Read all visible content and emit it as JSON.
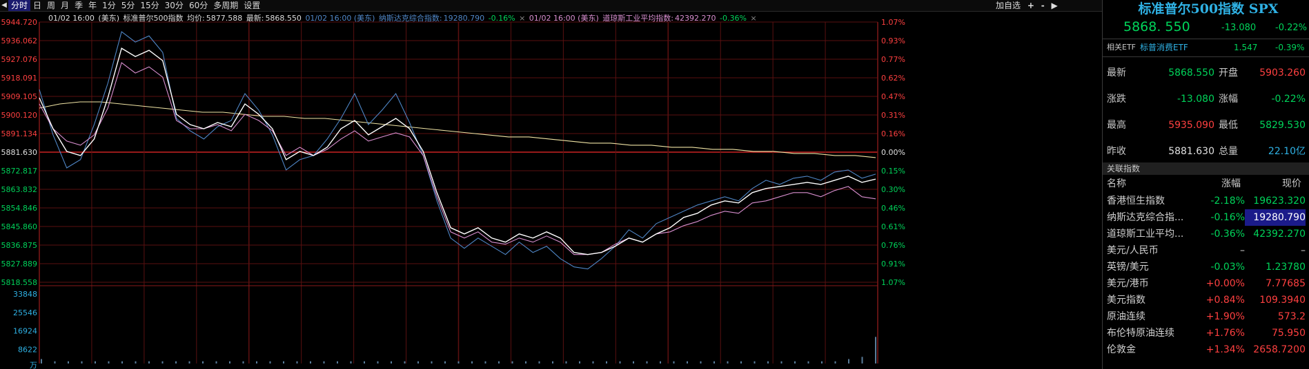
{
  "toolbar": {
    "periods": [
      "分时",
      "日",
      "周",
      "月",
      "季",
      "年",
      "1分",
      "5分",
      "15分",
      "30分",
      "60分",
      "多周期",
      "设置"
    ],
    "active_period": "分时",
    "add_watch_label": "加自选",
    "plus_label": "+",
    "minus_label": "-"
  },
  "info": {
    "time": "01/02 16:00",
    "tz": "(美东)",
    "name": "标准普尔500指数",
    "avg_label": "均价:",
    "avg": "5877.588",
    "latest_label": "最新:",
    "latest": "5868.550",
    "overlay1_label": "01/02 16:00 (美东)",
    "overlay1_name": "纳斯达克综合指数:",
    "overlay1_value": "19280.790",
    "overlay1_pct": "-0.16%",
    "overlay2_label": "01/02 16:00 (美东)",
    "overlay2_name": "道琼斯工业平均指数:",
    "overlay2_value": "42392.270",
    "overlay2_pct": "-0.36%",
    "close_symbol": "×"
  },
  "chart_data": {
    "type": "line",
    "price_axis_labels": [
      "5944.720",
      "5936.062",
      "5927.076",
      "5918.091",
      "5909.105",
      "5900.120",
      "5891.134",
      "5881.630",
      "5872.817",
      "5863.832",
      "5854.846",
      "5845.860",
      "5836.875",
      "5827.889",
      "5818.558"
    ],
    "pct_axis_labels": [
      "1.07%",
      "0.93%",
      "0.77%",
      "0.62%",
      "0.47%",
      "0.31%",
      "0.16%",
      "0.00%",
      "0.15%",
      "0.30%",
      "0.46%",
      "0.61%",
      "0.76%",
      "0.91%",
      "1.07%"
    ],
    "volume_axis_labels": [
      "33848",
      "25546",
      "16924",
      "8622",
      "万"
    ],
    "prev_close": 5881.63,
    "ylim": [
      5818.558,
      5944.72
    ],
    "sessions": 390,
    "series": [
      {
        "name": "标准普尔500指数",
        "color": "#ffffff",
        "values": [
          5908,
          5893,
          5882,
          5880,
          5888,
          5908,
          5932,
          5928,
          5931,
          5926,
          5900,
          5895,
          5893,
          5896,
          5894,
          5905,
          5900,
          5893,
          5878,
          5882,
          5880,
          5884,
          5893,
          5897,
          5890,
          5894,
          5898,
          5893,
          5882,
          5862,
          5845,
          5842,
          5845,
          5840,
          5838,
          5842,
          5840,
          5843,
          5840,
          5833,
          5832,
          5833,
          5836,
          5840,
          5838,
          5842,
          5845,
          5850,
          5852,
          5856,
          5858,
          5857,
          5862,
          5864,
          5865,
          5866,
          5867,
          5866,
          5868,
          5870,
          5867,
          5868.55
        ]
      },
      {
        "name": "纳斯达克综合指数",
        "color": "#4f86c6",
        "values": [
          5912,
          5890,
          5874,
          5878,
          5895,
          5915,
          5940,
          5935,
          5938,
          5930,
          5898,
          5892,
          5888,
          5894,
          5897,
          5910,
          5902,
          5890,
          5873,
          5878,
          5880,
          5888,
          5898,
          5910,
          5895,
          5902,
          5910,
          5896,
          5880,
          5858,
          5840,
          5835,
          5840,
          5836,
          5832,
          5838,
          5833,
          5836,
          5830,
          5826,
          5825,
          5830,
          5836,
          5844,
          5840,
          5847,
          5850,
          5853,
          5856,
          5858,
          5860,
          5858,
          5864,
          5868,
          5866,
          5869,
          5870,
          5868,
          5872,
          5873,
          5869,
          5871
        ]
      },
      {
        "name": "道琼斯工业平均指数",
        "color": "#d98fd0",
        "values": [
          5905,
          5893,
          5887,
          5885,
          5890,
          5903,
          5925,
          5920,
          5923,
          5918,
          5897,
          5893,
          5893,
          5895,
          5892,
          5900,
          5897,
          5892,
          5880,
          5884,
          5880,
          5883,
          5888,
          5892,
          5887,
          5889,
          5891,
          5889,
          5880,
          5860,
          5843,
          5840,
          5843,
          5838,
          5837,
          5840,
          5838,
          5841,
          5838,
          5832,
          5832,
          5833,
          5837,
          5840,
          5838,
          5842,
          5843,
          5846,
          5848,
          5851,
          5853,
          5852,
          5857,
          5858,
          5860,
          5862,
          5862,
          5860,
          5863,
          5865,
          5860,
          5859
        ]
      },
      {
        "name": "均价",
        "color": "#f2e6a6",
        "values": [
          5903,
          5905,
          5906,
          5906,
          5905,
          5904,
          5903,
          5902,
          5901,
          5901,
          5900,
          5899,
          5899,
          5898,
          5898,
          5897,
          5896,
          5895,
          5894,
          5893,
          5892,
          5891,
          5890,
          5889,
          5889,
          5888,
          5887,
          5886,
          5886,
          5885,
          5885,
          5884,
          5884,
          5883,
          5883,
          5882,
          5882,
          5881,
          5881,
          5880,
          5880,
          5879
        ]
      }
    ],
    "volume": [
      2,
      1,
      1,
      1,
      1,
      1,
      1,
      1,
      1,
      1,
      1,
      1,
      1,
      1,
      1,
      1,
      1,
      1,
      1,
      1,
      1,
      1,
      1,
      1,
      1,
      1,
      1,
      1,
      1,
      1,
      1,
      1,
      1,
      1,
      1,
      1,
      1,
      1,
      1,
      1,
      1,
      1,
      1,
      1,
      1,
      1,
      1,
      1,
      1,
      1,
      1,
      1,
      1,
      1,
      1,
      1,
      1,
      1,
      1,
      1,
      2,
      3,
      12
    ]
  },
  "side": {
    "title": "标准普尔500指数 SPX",
    "price": "5868. 550",
    "change": "-13.080",
    "pct": "-0.22%",
    "etf_label": "相关ETF",
    "etf_name": "标普消费ETF",
    "etf_price": "1.547",
    "etf_pct": "-0.39%",
    "rows": [
      {
        "l1": "最新",
        "v1": "5868.550",
        "c1": "down",
        "l2": "开盘",
        "v2": "5903.260",
        "c2": "up"
      },
      {
        "l1": "涨跌",
        "v1": "-13.080",
        "c1": "down",
        "l2": "涨幅",
        "v2": "-0.22%",
        "c2": "down"
      },
      {
        "l1": "最高",
        "v1": "5935.090",
        "c1": "up",
        "l2": "最低",
        "v2": "5829.530",
        "c2": "down"
      },
      {
        "l1": "昨收",
        "v1": "5881.630",
        "c1": "flat",
        "l2": "总量",
        "v2": "22.10亿",
        "c2": "cyan"
      }
    ],
    "related_header": "关联指数",
    "col_name": "名称",
    "col_pct": "涨幅",
    "col_price": "现价",
    "related": [
      {
        "name": "香港恒生指数",
        "pct": "-2.18%",
        "price": "19623.320",
        "dir": "down"
      },
      {
        "name": "纳斯达克综合指...",
        "pct": "-0.16%",
        "price": "19280.790",
        "dir": "down"
      },
      {
        "name": "道琼斯工业平均...",
        "pct": "-0.36%",
        "price": "42392.270",
        "dir": "down"
      },
      {
        "name": "美元/人民币",
        "pct": "–",
        "price": "–",
        "dir": "flat"
      },
      {
        "name": "英镑/美元",
        "pct": "-0.03%",
        "price": "1.23780",
        "dir": "down"
      },
      {
        "name": "美元/港币",
        "pct": "+0.00%",
        "price": "7.77685",
        "dir": "up"
      },
      {
        "name": "美元指数",
        "pct": "+0.84%",
        "price": "109.3940",
        "dir": "up"
      },
      {
        "name": "原油连续",
        "pct": "+1.90%",
        "price": "573.2",
        "dir": "up"
      },
      {
        "name": "布伦特原油连续",
        "pct": "+1.76%",
        "price": "75.950",
        "dir": "up"
      },
      {
        "name": "伦敦金",
        "pct": "+1.34%",
        "price": "2658.7200",
        "dir": "up"
      }
    ]
  }
}
